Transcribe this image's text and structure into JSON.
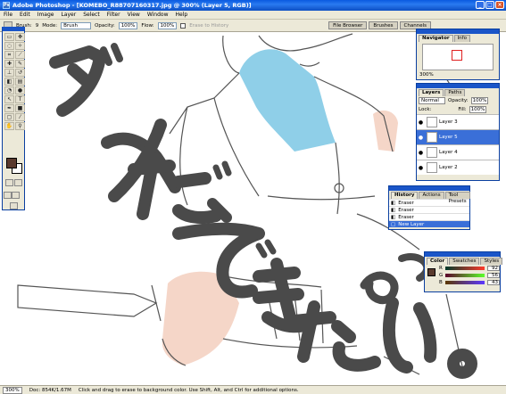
{
  "window": {
    "title": "Adobe Photoshop - [KOMEBO_R88707160317.jpg @ 300% (Layer 5, RGB)]",
    "controls": [
      "_",
      "□",
      "×"
    ]
  },
  "menu": [
    "File",
    "Edit",
    "Image",
    "Layer",
    "Select",
    "Filter",
    "View",
    "Window",
    "Help"
  ],
  "options": {
    "brush_label": "Brush:",
    "brush_size": "9",
    "mode_label": "Mode:",
    "mode_value": "Brush",
    "opacity_label": "Opacity:",
    "opacity_value": "100%",
    "flow_label": "Flow:",
    "flow_value": "100%",
    "history_label": "Erase to History"
  },
  "palette_well": [
    "File Browser",
    "Brushes",
    "Channels"
  ],
  "navigator": {
    "tabs": [
      "Navigator",
      "Info"
    ],
    "zoom": "300%"
  },
  "layers": {
    "tabs": [
      "Layers",
      "Paths"
    ],
    "blend_mode": "Normal",
    "opacity_label": "Opacity:",
    "opacity_value": "100%",
    "lock_label": "Lock:",
    "fill_label": "Fill:",
    "fill_value": "100%",
    "items": [
      {
        "name": "Layer 3",
        "selected": false
      },
      {
        "name": "Layer 5",
        "selected": true
      },
      {
        "name": "Layer 4",
        "selected": false
      },
      {
        "name": "Layer 2",
        "selected": false
      }
    ]
  },
  "history": {
    "tabs": [
      "History",
      "Actions",
      "Tool Presets"
    ],
    "items": [
      {
        "name": "Eraser",
        "selected": false
      },
      {
        "name": "Eraser",
        "selected": false
      },
      {
        "name": "Eraser",
        "selected": false
      },
      {
        "name": "New Layer",
        "selected": true
      }
    ]
  },
  "color": {
    "tabs": [
      "Color",
      "Swatches",
      "Styles"
    ],
    "channels": [
      {
        "label": "R",
        "value": "92"
      },
      {
        "label": "G",
        "value": "56"
      },
      {
        "label": "B",
        "value": "43"
      }
    ]
  },
  "status": {
    "zoom": "300%",
    "doc": "Doc: 854K/1.67M",
    "hint": "Click and drag to erase to background color. Use Shift, Alt, and Ctrl for additional options."
  },
  "colors": {
    "xp_blue": "#1a55c8",
    "fg_color": "#5a3a2e",
    "shirt_blue": "#8fcfe8",
    "skin": "#f5d6c8",
    "ink": "#4a4a4a"
  }
}
